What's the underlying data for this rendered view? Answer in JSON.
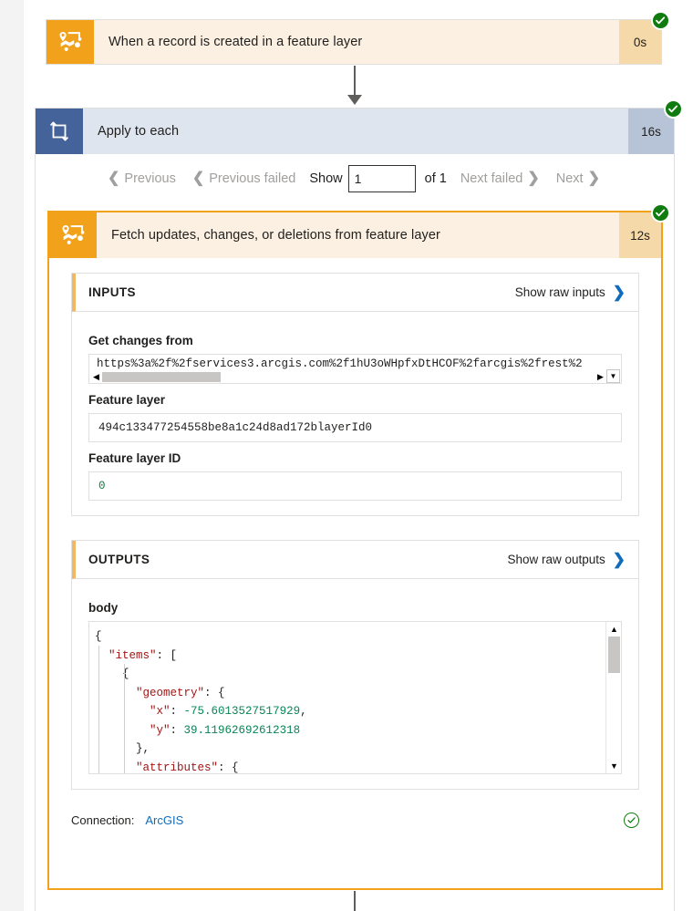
{
  "trigger": {
    "icon": "arcgis-feature-layer-icon",
    "title": "When a record is created in a feature layer",
    "duration": "0s",
    "status": "succeeded"
  },
  "loop": {
    "icon": "apply-to-each-loop-icon",
    "title": "Apply to each",
    "duration": "16s",
    "status": "succeeded",
    "pager": {
      "previous": "Previous",
      "previous_failed": "Previous failed",
      "show": "Show",
      "page_value": "1",
      "of": "of 1",
      "next_failed": "Next failed",
      "next": "Next"
    }
  },
  "action": {
    "icon": "arcgis-feature-layer-icon",
    "title": "Fetch updates, changes, or deletions from feature layer",
    "duration": "12s",
    "status": "succeeded",
    "inputs": {
      "heading": "INPUTS",
      "raw_link": "Show raw inputs",
      "fields": [
        {
          "label": "Get changes from",
          "value": "https%3a%2f%2fservices3.arcgis.com%2f1hU3oWHpfxDtHCOF%2farcgis%2frest%2"
        },
        {
          "label": "Feature layer",
          "value": "494c133477254558be8a1c24d8ad172blayerId0"
        },
        {
          "label": "Feature layer ID",
          "value": "0"
        }
      ]
    },
    "outputs": {
      "heading": "OUTPUTS",
      "raw_link": "Show raw outputs",
      "body_label": "body",
      "body_lines": [
        {
          "indent": 0,
          "parts": [
            {
              "t": "{",
              "c": "punc"
            }
          ]
        },
        {
          "indent": 1,
          "parts": [
            {
              "t": "\"items\"",
              "c": "key"
            },
            {
              "t": ": [",
              "c": "punc"
            }
          ]
        },
        {
          "indent": 2,
          "parts": [
            {
              "t": "{",
              "c": "punc"
            }
          ]
        },
        {
          "indent": 3,
          "parts": [
            {
              "t": "\"geometry\"",
              "c": "key"
            },
            {
              "t": ": {",
              "c": "punc"
            }
          ]
        },
        {
          "indent": 4,
          "parts": [
            {
              "t": "\"x\"",
              "c": "key"
            },
            {
              "t": ": ",
              "c": "punc"
            },
            {
              "t": "-75.6013527517929",
              "c": "num"
            },
            {
              "t": ",",
              "c": "punc"
            }
          ]
        },
        {
          "indent": 4,
          "parts": [
            {
              "t": "\"y\"",
              "c": "key"
            },
            {
              "t": ": ",
              "c": "punc"
            },
            {
              "t": "39.11962692612318",
              "c": "num"
            }
          ]
        },
        {
          "indent": 3,
          "parts": [
            {
              "t": "},",
              "c": "punc"
            }
          ]
        },
        {
          "indent": 3,
          "parts": [
            {
              "t": "\"attributes\"",
              "c": "key"
            },
            {
              "t": ": {",
              "c": "punc"
            }
          ]
        }
      ]
    },
    "connection": {
      "label": "Connection:",
      "value": "ArcGIS",
      "status": "ok"
    }
  },
  "colors": {
    "accent_orange": "#f2a11b",
    "card_cream": "#fbf0e1",
    "duration_tan": "#f6d9a8",
    "loop_blue": "#45639b",
    "loop_header": "#dee5ef",
    "loop_duration": "#b7c3d6",
    "success_green": "#107c10",
    "link_blue": "#0f6cbd",
    "json_key": "#a31515",
    "json_number": "#098658"
  }
}
